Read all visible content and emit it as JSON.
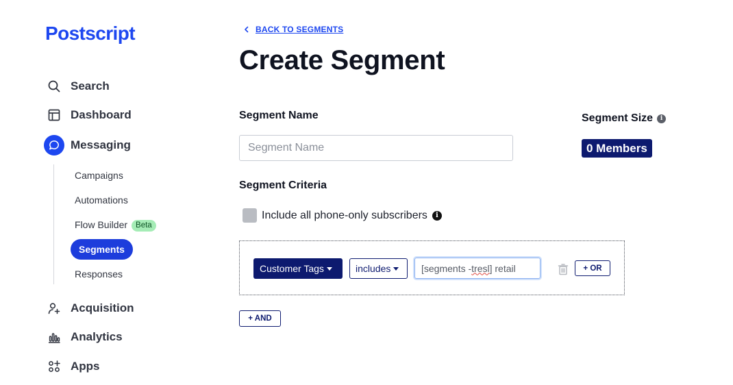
{
  "brand": {
    "logo_text": "Postscript",
    "color": "#1d47f0"
  },
  "sidebar": {
    "items": [
      {
        "label": "Search",
        "icon": "search-icon"
      },
      {
        "label": "Dashboard",
        "icon": "dashboard-icon"
      },
      {
        "label": "Messaging",
        "icon": "chat-bubble-icon",
        "active": true
      },
      {
        "label": "Acquisition",
        "icon": "add-user-icon"
      },
      {
        "label": "Analytics",
        "icon": "bar-chart-icon"
      },
      {
        "label": "Apps",
        "icon": "apps-icon"
      }
    ],
    "messaging_sub": [
      {
        "label": "Campaigns"
      },
      {
        "label": "Automations"
      },
      {
        "label": "Flow Builder",
        "badge": "Beta"
      },
      {
        "label": "Segments",
        "active": true
      },
      {
        "label": "Responses"
      }
    ]
  },
  "main": {
    "back_link": "BACK TO SEGMENTS",
    "title": "Create Segment",
    "segment_name": {
      "label": "Segment Name",
      "placeholder": "Segment Name",
      "value": ""
    },
    "segment_size": {
      "label": "Segment Size",
      "members": "0 Members"
    },
    "criteria": {
      "label": "Segment Criteria",
      "phone_only_label": "Include all phone-only subscribers",
      "phone_only_checked": false,
      "rule": {
        "field": "Customer Tags",
        "operator": "includes",
        "value_prefix": "[segments - ",
        "value_misspelled": "tresl",
        "value_suffix": "] retail"
      },
      "or_button": "+ OR",
      "and_button": "+ AND"
    }
  },
  "colors": {
    "accent": "#1d47f0",
    "navy": "#0d1a6f",
    "beta_bg": "#a5ecb6"
  }
}
